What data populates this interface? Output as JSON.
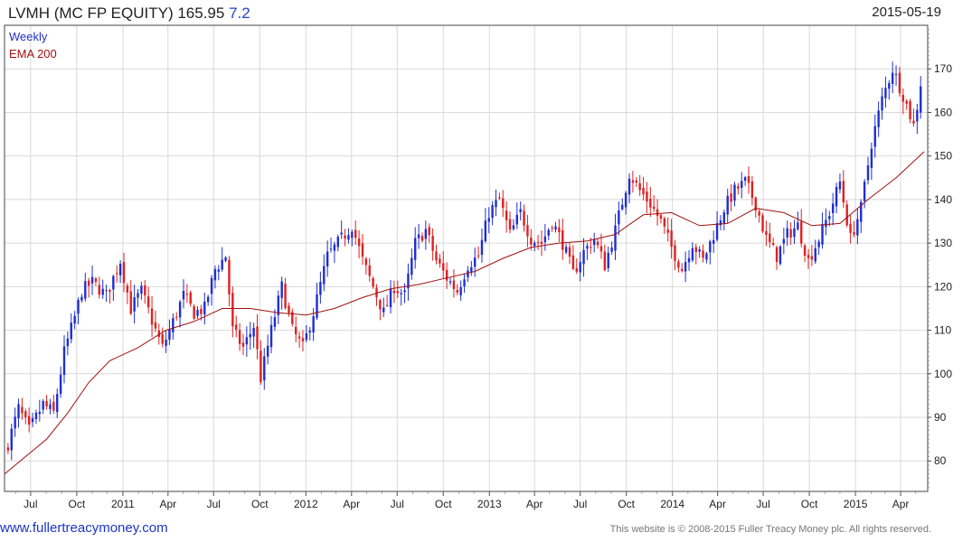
{
  "header": {
    "title": "LVMH (MC FP EQUITY) 165.95",
    "change": "7.2",
    "date": "2015-05-19"
  },
  "footer": {
    "url": "www.fullertreacymoney.com",
    "copyright": "This website is © 2008-2015 Fuller Treacy Money plc. All rights reserved."
  },
  "colors": {
    "up": "#1f2fd0",
    "down": "#e02020",
    "ema": "#a01010",
    "grid": "#d9d9d9"
  },
  "chart_data": {
    "type": "candlestick",
    "frequency_label": "Weekly",
    "legend": [
      "Weekly",
      "EMA 200"
    ],
    "ylim": [
      73,
      180
    ],
    "y_ticks": [
      80,
      90,
      100,
      110,
      120,
      130,
      140,
      150,
      160,
      170
    ],
    "x_range": [
      "2010-05-10",
      "2015-05-25"
    ],
    "x_ticks": [
      {
        "label": "Jul",
        "date": "2010-07-01"
      },
      {
        "label": "Oct",
        "date": "2010-10-01"
      },
      {
        "label": "2011",
        "date": "2011-01-01"
      },
      {
        "label": "Apr",
        "date": "2011-04-01"
      },
      {
        "label": "Jul",
        "date": "2011-07-01"
      },
      {
        "label": "Oct",
        "date": "2011-10-01"
      },
      {
        "label": "2012",
        "date": "2012-01-01"
      },
      {
        "label": "Apr",
        "date": "2012-04-01"
      },
      {
        "label": "Jul",
        "date": "2012-07-01"
      },
      {
        "label": "Oct",
        "date": "2012-10-01"
      },
      {
        "label": "2013",
        "date": "2013-01-01"
      },
      {
        "label": "Apr",
        "date": "2013-04-01"
      },
      {
        "label": "Jul",
        "date": "2013-07-01"
      },
      {
        "label": "Oct",
        "date": "2013-10-01"
      },
      {
        "label": "2014",
        "date": "2014-01-01"
      },
      {
        "label": "Apr",
        "date": "2014-04-01"
      },
      {
        "label": "Jul",
        "date": "2014-07-01"
      },
      {
        "label": "Oct",
        "date": "2014-10-01"
      },
      {
        "label": "2015",
        "date": "2015-01-01"
      },
      {
        "label": "Apr",
        "date": "2015-04-01"
      }
    ],
    "close_path": [
      [
        "2010-05-17",
        84
      ],
      [
        "2010-06-07",
        92
      ],
      [
        "2010-06-28",
        87
      ],
      [
        "2010-07-26",
        93
      ],
      [
        "2010-08-16",
        91
      ],
      [
        "2010-09-06",
        105
      ],
      [
        "2010-09-27",
        113
      ],
      [
        "2010-10-11",
        119
      ],
      [
        "2010-11-01",
        121
      ],
      [
        "2010-11-29",
        118
      ],
      [
        "2010-12-27",
        126
      ],
      [
        "2011-01-17",
        115
      ],
      [
        "2011-02-07",
        119
      ],
      [
        "2011-03-07",
        110
      ],
      [
        "2011-03-21",
        106
      ],
      [
        "2011-04-11",
        112
      ],
      [
        "2011-05-02",
        118
      ],
      [
        "2011-05-23",
        114
      ],
      [
        "2011-06-13",
        115
      ],
      [
        "2011-07-04",
        124
      ],
      [
        "2011-07-25",
        127
      ],
      [
        "2011-08-08",
        110
      ],
      [
        "2011-08-29",
        106
      ],
      [
        "2011-09-19",
        111
      ],
      [
        "2011-10-03",
        99
      ],
      [
        "2011-10-24",
        110
      ],
      [
        "2011-11-14",
        120
      ],
      [
        "2011-12-05",
        110
      ],
      [
        "2011-12-26",
        106
      ],
      [
        "2012-01-16",
        114
      ],
      [
        "2012-02-13",
        127
      ],
      [
        "2012-03-12",
        131
      ],
      [
        "2012-04-02",
        134
      ],
      [
        "2012-04-23",
        126
      ],
      [
        "2012-05-14",
        120
      ],
      [
        "2012-06-04",
        114
      ],
      [
        "2012-06-25",
        120
      ],
      [
        "2012-07-16",
        118
      ],
      [
        "2012-08-06",
        130
      ],
      [
        "2012-08-27",
        133
      ],
      [
        "2012-09-17",
        126
      ],
      [
        "2012-10-08",
        122
      ],
      [
        "2012-10-29",
        119
      ],
      [
        "2012-11-19",
        125
      ],
      [
        "2012-12-10",
        127
      ],
      [
        "2012-12-31",
        137
      ],
      [
        "2013-01-21",
        140
      ],
      [
        "2013-02-11",
        132
      ],
      [
        "2013-03-04",
        137
      ],
      [
        "2013-03-25",
        131
      ],
      [
        "2013-04-15",
        130
      ],
      [
        "2013-05-06",
        135
      ],
      [
        "2013-05-27",
        130
      ],
      [
        "2013-06-17",
        123
      ],
      [
        "2013-07-08",
        128
      ],
      [
        "2013-07-29",
        131
      ],
      [
        "2013-08-19",
        125
      ],
      [
        "2013-09-09",
        133
      ],
      [
        "2013-10-07",
        146
      ],
      [
        "2013-10-28",
        142
      ],
      [
        "2013-11-18",
        139
      ],
      [
        "2013-12-09",
        135
      ],
      [
        "2013-12-30",
        129
      ],
      [
        "2014-01-20",
        124
      ],
      [
        "2014-02-10",
        130
      ],
      [
        "2014-03-03",
        126
      ],
      [
        "2014-03-24",
        132
      ],
      [
        "2014-04-14",
        138
      ],
      [
        "2014-05-05",
        142
      ],
      [
        "2014-05-26",
        144
      ],
      [
        "2014-06-16",
        139
      ],
      [
        "2014-07-07",
        131
      ],
      [
        "2014-07-28",
        127
      ],
      [
        "2014-08-18",
        132
      ],
      [
        "2014-09-08",
        134
      ],
      [
        "2014-09-29",
        126
      ],
      [
        "2014-10-20",
        131
      ],
      [
        "2014-11-10",
        137
      ],
      [
        "2014-12-01",
        144
      ],
      [
        "2014-12-22",
        131
      ],
      [
        "2015-01-12",
        138
      ],
      [
        "2015-02-02",
        153
      ],
      [
        "2015-02-23",
        163
      ],
      [
        "2015-03-16",
        170
      ],
      [
        "2015-04-06",
        164
      ],
      [
        "2015-04-27",
        157
      ],
      [
        "2015-05-11",
        165.95
      ]
    ],
    "ema_path": [
      [
        "2010-05-10",
        77
      ],
      [
        "2010-06-21",
        81
      ],
      [
        "2010-08-02",
        85
      ],
      [
        "2010-09-13",
        91
      ],
      [
        "2010-10-25",
        98
      ],
      [
        "2010-12-06",
        103
      ],
      [
        "2011-01-31",
        106
      ],
      [
        "2011-03-28",
        110
      ],
      [
        "2011-05-23",
        112
      ],
      [
        "2011-07-18",
        115
      ],
      [
        "2011-09-12",
        115
      ],
      [
        "2011-11-07",
        114
      ],
      [
        "2012-01-02",
        113.5
      ],
      [
        "2012-02-27",
        115
      ],
      [
        "2012-04-23",
        117.5
      ],
      [
        "2012-06-18",
        119.5
      ],
      [
        "2012-08-13",
        120.5
      ],
      [
        "2012-10-08",
        122
      ],
      [
        "2012-12-03",
        123.5
      ],
      [
        "2013-01-28",
        126.5
      ],
      [
        "2013-03-25",
        129
      ],
      [
        "2013-05-20",
        130
      ],
      [
        "2013-07-15",
        130.5
      ],
      [
        "2013-09-09",
        132
      ],
      [
        "2013-11-04",
        136.5
      ],
      [
        "2013-12-30",
        137
      ],
      [
        "2014-02-24",
        134
      ],
      [
        "2014-04-21",
        134.5
      ],
      [
        "2014-06-16",
        138
      ],
      [
        "2014-08-11",
        137
      ],
      [
        "2014-10-06",
        134
      ],
      [
        "2014-12-01",
        134.5
      ],
      [
        "2015-01-26",
        140
      ],
      [
        "2015-03-23",
        145
      ],
      [
        "2015-05-18",
        151
      ]
    ]
  }
}
